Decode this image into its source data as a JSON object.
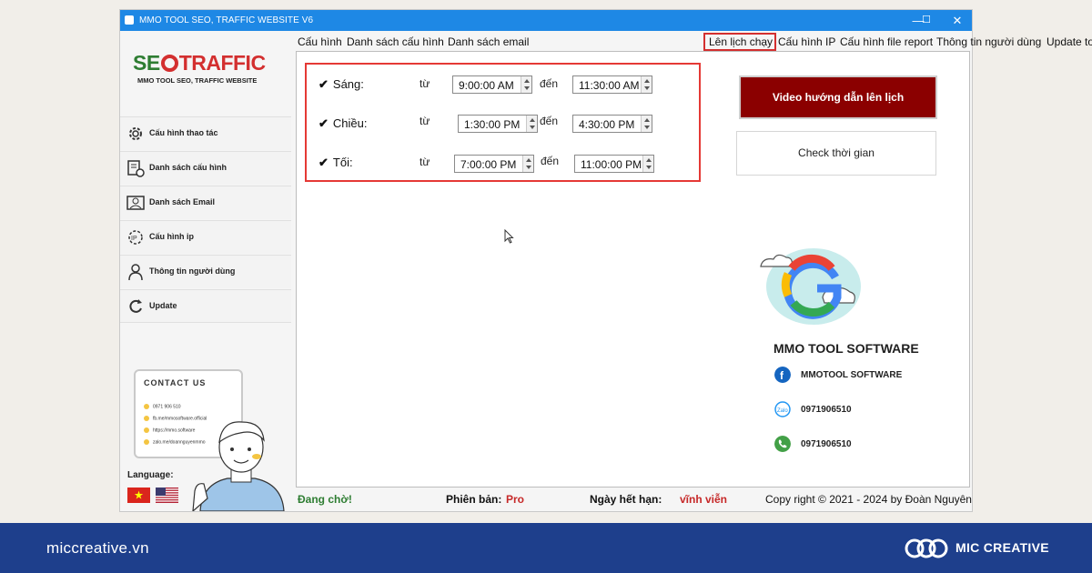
{
  "window": {
    "title": "MMO TOOL SEO, TRAFFIC WEBSITE V6",
    "minimize": "—",
    "maximize": "☐",
    "close": "✕"
  },
  "logo": {
    "part1": "SE",
    "part2": "TRAFFIC",
    "subtitle": "MMO TOOL SEO, TRAFFIC WEBSITE"
  },
  "sidebar": {
    "items": [
      {
        "label": "Cấu hình thao tác",
        "icon": "gear-icon"
      },
      {
        "label": "Danh sách cấu hình",
        "icon": "list-clock-icon"
      },
      {
        "label": "Danh sách Email",
        "icon": "email-user-icon"
      },
      {
        "label": "Cấu hình ip",
        "icon": "ip-gear-icon"
      },
      {
        "label": "Thông tin người dùng",
        "icon": "user-icon"
      },
      {
        "label": "Update",
        "icon": "refresh-icon"
      }
    ],
    "contact": {
      "title": "CONTACT US",
      "lines": [
        "0971 906 510",
        "fb.me/mmosoftware.official",
        "https://mmo.software",
        "zalo.me/doannguyenmmo"
      ]
    },
    "language_label": "Language:",
    "languages": [
      "vietnamese-flag",
      "us-flag"
    ]
  },
  "tabs": [
    "Cấu hình",
    "Danh sách cấu hình",
    "Danh sách email",
    "Lên lịch chạy",
    "Cấu hình IP",
    "Cấu hình file report",
    "Thông tin người dùng",
    "Update tool"
  ],
  "active_tab": "Lên lịch chạy",
  "schedule": {
    "from_label": "từ",
    "to_label": "đến",
    "check_mark": "✔",
    "rows": [
      {
        "label": "Sáng:",
        "checked": true,
        "from": "9:00:00 AM",
        "to": "11:30:00 AM"
      },
      {
        "label": "Chiều:",
        "checked": true,
        "from": "1:30:00 PM",
        "to": "4:30:00 PM"
      },
      {
        "label": "Tối:",
        "checked": true,
        "from": "7:00:00 PM",
        "to": "11:00:00 PM"
      }
    ]
  },
  "buttons": {
    "video_guide": "Video hướng dẫn lên lịch",
    "check_time": "Check thời gian"
  },
  "brand": {
    "title": "MMO TOOL SOFTWARE",
    "facebook": "MMOTOOL SOFTWARE",
    "zalo": "0971906510",
    "phone": "0971906510"
  },
  "status": {
    "state": "Đang chờ!",
    "version_label": "Phiên bản:",
    "version_value": "Pro",
    "expiry_label": "Ngày hết hạn:",
    "expiry_value": "vĩnh viễn",
    "copyright": "Copy right © 2021 - 2024 by Đoàn Nguyên"
  },
  "footer": {
    "site": "miccreative.vn",
    "brand": "MIC CREATIVE"
  },
  "colors": {
    "titlebar": "#1e88e5",
    "highlight_red": "#e53935",
    "video_button": "#8b0000",
    "status_green": "#2e7d32",
    "status_red": "#c62828",
    "footer_bg": "#1e3f8c"
  }
}
